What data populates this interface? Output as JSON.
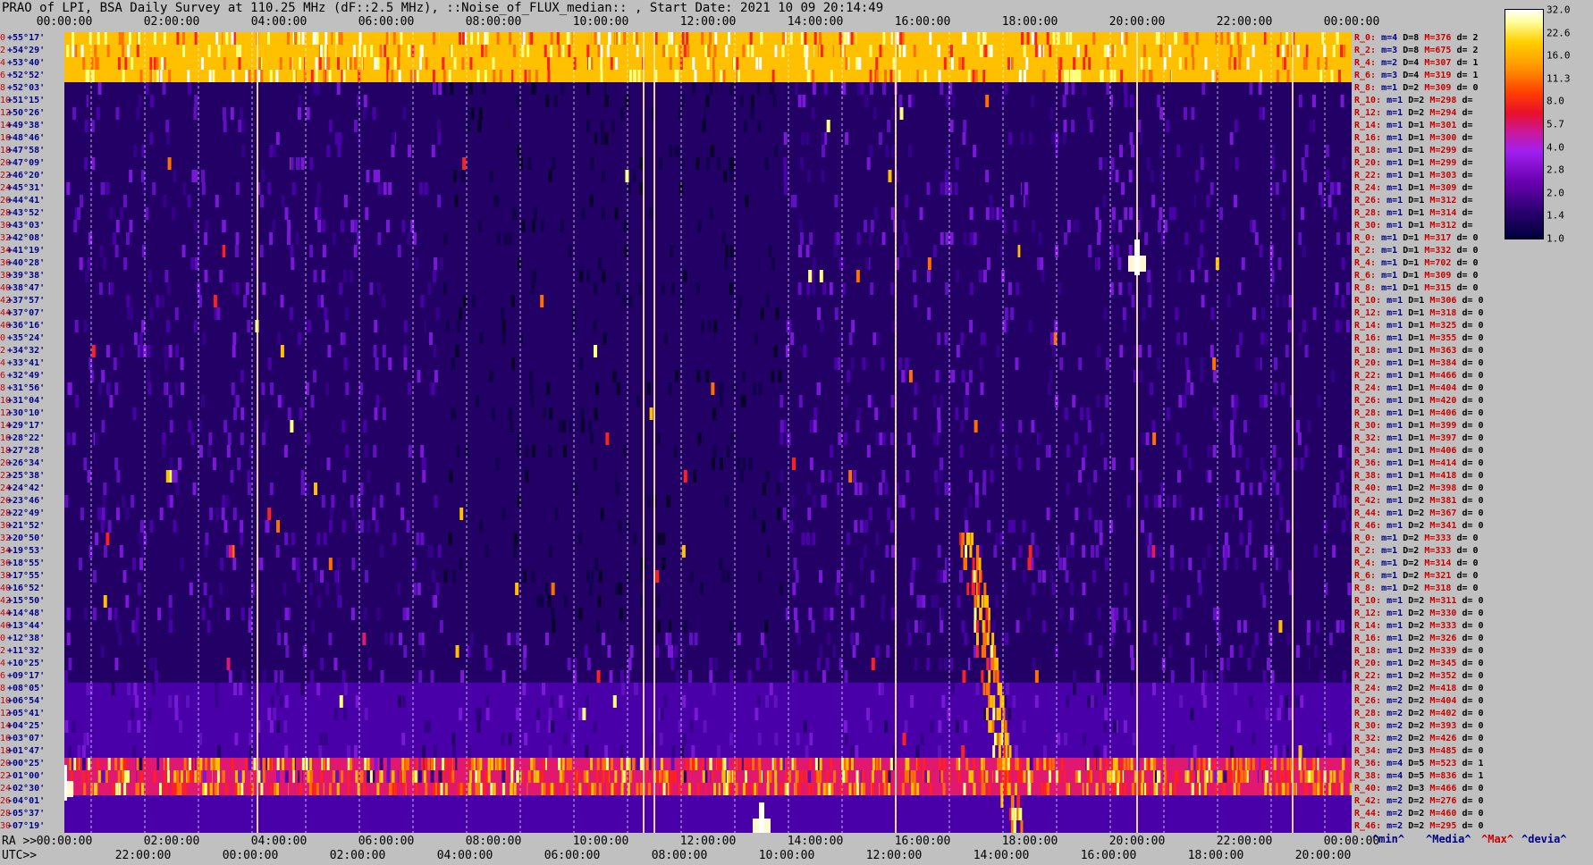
{
  "title": "PRAO of LPI, BSA Daily Survey at 110.25 MHz (dF::2.5 MHz), ::Noise_of_FLUX_median:: , Start Date: 2021 10 09 20:14:49",
  "top_time_ticks": [
    "00:00:00",
    "02:00:00",
    "04:00:00",
    "06:00:00",
    "08:00:00",
    "10:00:00",
    "12:00:00",
    "14:00:00",
    "16:00:00",
    "18:00:00",
    "20:00:00",
    "22:00:00",
    "00:00:00"
  ],
  "bottom_ra_label": "RA >>",
  "bottom_utc_label": "UTC>>",
  "bottom_ra_ticks": [
    "00:00:00",
    "02:00:00",
    "04:00:00",
    "06:00:00",
    "08:00:00",
    "10:00:00",
    "12:00:00",
    "14:00:00",
    "16:00:00",
    "18:00:00",
    "20:00:00",
    "22:00:00",
    "00:00:00"
  ],
  "bottom_utc_ticks": [
    "22:00:00",
    "00:00:00",
    "02:00:00",
    "04:00:00",
    "06:00:00",
    "08:00:00",
    "10:00:00",
    "12:00:00",
    "14:00:00",
    "16:00:00",
    "18:00:00",
    "20:00:00"
  ],
  "colorbar": {
    "labels": [
      "32.0",
      "22.6",
      "16.0",
      "11.3",
      "8.0",
      "5.7",
      "4.0",
      "2.8",
      "2.0",
      "1.4",
      "1.0"
    ],
    "colors": [
      "#00003a",
      "#6a00b0",
      "#c818a0",
      "#e8102a",
      "#ff9000",
      "#ffffa0",
      "#ffffff"
    ]
  },
  "legend": {
    "min": "^min^",
    "media": "^Media^",
    "max": "^Max^",
    "devia": "^devia^"
  },
  "rows": [
    {
      "idx": "0",
      "dec": "+55°17'",
      "stat": {
        "r": "R_0:",
        "m": "m=4",
        "D": "D=8",
        "M": "M=376",
        "d": "d= 2"
      }
    },
    {
      "idx": "2",
      "dec": "+54°29'",
      "stat": {
        "r": "R_2:",
        "m": "m=3",
        "D": "D=8",
        "M": "M=675",
        "d": "d= 2"
      }
    },
    {
      "idx": "4",
      "dec": "+53°40'",
      "stat": {
        "r": "R_4:",
        "m": "m=2",
        "D": "D=4",
        "M": "M=307",
        "d": "d= 1"
      }
    },
    {
      "idx": "6",
      "dec": "+52°52'",
      "stat": {
        "r": "R_6:",
        "m": "m=3",
        "D": "D=4",
        "M": "M=319",
        "d": "d= 1"
      }
    },
    {
      "idx": "8",
      "dec": "+52°03'",
      "stat": {
        "r": "R_8:",
        "m": "m=1",
        "D": "D=2",
        "M": "M=309",
        "d": "d= 0"
      }
    },
    {
      "idx": "10",
      "dec": "+51°15'",
      "stat": {
        "r": "R_10:",
        "m": "m=1",
        "D": "D=2",
        "M": "M=298",
        "d": "d="
      }
    },
    {
      "idx": "12",
      "dec": "+50°26'",
      "stat": {
        "r": "R_12:",
        "m": "m=1",
        "D": "D=2",
        "M": "M=294",
        "d": "d="
      }
    },
    {
      "idx": "14",
      "dec": "+49°38'",
      "stat": {
        "r": "R_14:",
        "m": "m=1",
        "D": "D=1",
        "M": "M=301",
        "d": "d="
      }
    },
    {
      "idx": "16",
      "dec": "+48°46'",
      "stat": {
        "r": "R_16:",
        "m": "m=1",
        "D": "D=1",
        "M": "M=300",
        "d": "d="
      }
    },
    {
      "idx": "18",
      "dec": "+47°58'",
      "stat": {
        "r": "R_18:",
        "m": "m=1",
        "D": "D=1",
        "M": "M=299",
        "d": "d="
      }
    },
    {
      "idx": "20",
      "dec": "+47°09'",
      "stat": {
        "r": "R_20:",
        "m": "m=1",
        "D": "D=1",
        "M": "M=299",
        "d": "d="
      }
    },
    {
      "idx": "22",
      "dec": "+46°20'",
      "stat": {
        "r": "R_22:",
        "m": "m=1",
        "D": "D=1",
        "M": "M=303",
        "d": "d="
      }
    },
    {
      "idx": "24",
      "dec": "+45°31'",
      "stat": {
        "r": "R_24:",
        "m": "m=1",
        "D": "D=1",
        "M": "M=309",
        "d": "d="
      }
    },
    {
      "idx": "26",
      "dec": "+44°41'",
      "stat": {
        "r": "R_26:",
        "m": "m=1",
        "D": "D=1",
        "M": "M=312",
        "d": "d="
      }
    },
    {
      "idx": "28",
      "dec": "+43°52'",
      "stat": {
        "r": "R_28:",
        "m": "m=1",
        "D": "D=1",
        "M": "M=314",
        "d": "d="
      }
    },
    {
      "idx": "30",
      "dec": "+43°03'",
      "stat": {
        "r": "R_30:",
        "m": "m=1",
        "D": "D=1",
        "M": "M=312",
        "d": "d="
      }
    },
    {
      "idx": "32",
      "dec": "+42°08'",
      "stat": {
        "r": "R_0:",
        "m": "m=1",
        "D": "D=1",
        "M": "M=317",
        "d": "d= 0"
      }
    },
    {
      "idx": "34",
      "dec": "+41°19'",
      "stat": {
        "r": "R_2:",
        "m": "m=1",
        "D": "D=1",
        "M": "M=332",
        "d": "d= 0"
      }
    },
    {
      "idx": "36",
      "dec": "+40°28'",
      "stat": {
        "r": "R_4:",
        "m": "m=1",
        "D": "D=1",
        "M": "M=702",
        "d": "d= 0"
      }
    },
    {
      "idx": "38",
      "dec": "+39°38'",
      "stat": {
        "r": "R_6:",
        "m": "m=1",
        "D": "D=1",
        "M": "M=309",
        "d": "d= 0"
      }
    },
    {
      "idx": "40",
      "dec": "+38°47'",
      "stat": {
        "r": "R_8:",
        "m": "m=1",
        "D": "D=1",
        "M": "M=315",
        "d": "d= 0"
      }
    },
    {
      "idx": "42",
      "dec": "+37°57'",
      "stat": {
        "r": "R_10:",
        "m": "m=1",
        "D": "D=1",
        "M": "M=306",
        "d": "d= 0"
      }
    },
    {
      "idx": "44",
      "dec": "+37°07'",
      "stat": {
        "r": "R_12:",
        "m": "m=1",
        "D": "D=1",
        "M": "M=318",
        "d": "d= 0"
      }
    },
    {
      "idx": "46",
      "dec": "+36°16'",
      "stat": {
        "r": "R_14:",
        "m": "m=1",
        "D": "D=1",
        "M": "M=325",
        "d": "d= 0"
      }
    },
    {
      "idx": "0",
      "dec": "+35°24'",
      "stat": {
        "r": "R_16:",
        "m": "m=1",
        "D": "D=1",
        "M": "M=355",
        "d": "d= 0"
      }
    },
    {
      "idx": "2",
      "dec": "+34°32'",
      "stat": {
        "r": "R_18:",
        "m": "m=1",
        "D": "D=1",
        "M": "M=363",
        "d": "d= 0"
      }
    },
    {
      "idx": "4",
      "dec": "+33°41'",
      "stat": {
        "r": "R_20:",
        "m": "m=1",
        "D": "D=1",
        "M": "M=384",
        "d": "d= 0"
      }
    },
    {
      "idx": "6",
      "dec": "+32°49'",
      "stat": {
        "r": "R_22:",
        "m": "m=1",
        "D": "D=1",
        "M": "M=466",
        "d": "d= 0"
      }
    },
    {
      "idx": "8",
      "dec": "+31°56'",
      "stat": {
        "r": "R_24:",
        "m": "m=1",
        "D": "D=1",
        "M": "M=404",
        "d": "d= 0"
      }
    },
    {
      "idx": "10",
      "dec": "+31°04'",
      "stat": {
        "r": "R_26:",
        "m": "m=1",
        "D": "D=1",
        "M": "M=420",
        "d": "d= 0"
      }
    },
    {
      "idx": "12",
      "dec": "+30°10'",
      "stat": {
        "r": "R_28:",
        "m": "m=1",
        "D": "D=1",
        "M": "M=406",
        "d": "d= 0"
      }
    },
    {
      "idx": "14",
      "dec": "+29°17'",
      "stat": {
        "r": "R_30:",
        "m": "m=1",
        "D": "D=1",
        "M": "M=399",
        "d": "d= 0"
      }
    },
    {
      "idx": "16",
      "dec": "+28°22'",
      "stat": {
        "r": "R_32:",
        "m": "m=1",
        "D": "D=1",
        "M": "M=397",
        "d": "d= 0"
      }
    },
    {
      "idx": "18",
      "dec": "+27°28'",
      "stat": {
        "r": "R_34:",
        "m": "m=1",
        "D": "D=1",
        "M": "M=406",
        "d": "d= 0"
      }
    },
    {
      "idx": "20",
      "dec": "+26°34'",
      "stat": {
        "r": "R_36:",
        "m": "m=1",
        "D": "D=1",
        "M": "M=414",
        "d": "d= 0"
      }
    },
    {
      "idx": "22",
      "dec": "+25°38'",
      "stat": {
        "r": "R_38:",
        "m": "m=1",
        "D": "D=1",
        "M": "M=418",
        "d": "d= 0"
      }
    },
    {
      "idx": "24",
      "dec": "+24°42'",
      "stat": {
        "r": "R_40:",
        "m": "m=1",
        "D": "D=2",
        "M": "M=398",
        "d": "d= 0"
      }
    },
    {
      "idx": "26",
      "dec": "+23°46'",
      "stat": {
        "r": "R_42:",
        "m": "m=1",
        "D": "D=2",
        "M": "M=381",
        "d": "d= 0"
      }
    },
    {
      "idx": "28",
      "dec": "+22°49'",
      "stat": {
        "r": "R_44:",
        "m": "m=1",
        "D": "D=2",
        "M": "M=367",
        "d": "d= 0"
      }
    },
    {
      "idx": "30",
      "dec": "+21°52'",
      "stat": {
        "r": "R_46:",
        "m": "m=1",
        "D": "D=2",
        "M": "M=341",
        "d": "d= 0"
      }
    },
    {
      "idx": "32",
      "dec": "+20°50'",
      "stat": {
        "r": "R_0:",
        "m": "m=1",
        "D": "D=2",
        "M": "M=333",
        "d": "d= 0"
      }
    },
    {
      "idx": "34",
      "dec": "+19°53'",
      "stat": {
        "r": "R_2:",
        "m": "m=1",
        "D": "D=2",
        "M": "M=333",
        "d": "d= 0"
      }
    },
    {
      "idx": "36",
      "dec": "+18°55'",
      "stat": {
        "r": "R_4:",
        "m": "m=1",
        "D": "D=2",
        "M": "M=314",
        "d": "d= 0"
      }
    },
    {
      "idx": "38",
      "dec": "+17°55'",
      "stat": {
        "r": "R_6:",
        "m": "m=1",
        "D": "D=2",
        "M": "M=321",
        "d": "d= 0"
      }
    },
    {
      "idx": "40",
      "dec": "+16°52'",
      "stat": {
        "r": "R_8:",
        "m": "m=1",
        "D": "D=2",
        "M": "M=318",
        "d": "d= 0"
      }
    },
    {
      "idx": "42",
      "dec": "+15°50'",
      "stat": {
        "r": "R_10:",
        "m": "m=1",
        "D": "D=2",
        "M": "M=311",
        "d": "d= 0"
      }
    },
    {
      "idx": "44",
      "dec": "+14°48'",
      "stat": {
        "r": "R_12:",
        "m": "m=1",
        "D": "D=2",
        "M": "M=330",
        "d": "d= 0"
      }
    },
    {
      "idx": "46",
      "dec": "+13°44'",
      "stat": {
        "r": "R_14:",
        "m": "m=1",
        "D": "D=2",
        "M": "M=333",
        "d": "d= 0"
      }
    },
    {
      "idx": "0",
      "dec": "+12°38'",
      "stat": {
        "r": "R_16:",
        "m": "m=1",
        "D": "D=2",
        "M": "M=326",
        "d": "d= 0"
      }
    },
    {
      "idx": "2",
      "dec": "+11°32'",
      "stat": {
        "r": "R_18:",
        "m": "m=1",
        "D": "D=2",
        "M": "M=339",
        "d": "d= 0"
      }
    },
    {
      "idx": "4",
      "dec": "+10°25'",
      "stat": {
        "r": "R_20:",
        "m": "m=1",
        "D": "D=2",
        "M": "M=345",
        "d": "d= 0"
      }
    },
    {
      "idx": "6",
      "dec": "+09°17'",
      "stat": {
        "r": "R_22:",
        "m": "m=1",
        "D": "D=2",
        "M": "M=352",
        "d": "d= 0"
      }
    },
    {
      "idx": "8",
      "dec": "+08°05'",
      "stat": {
        "r": "R_24:",
        "m": "m=2",
        "D": "D=2",
        "M": "M=418",
        "d": "d= 0"
      }
    },
    {
      "idx": "10",
      "dec": "+06°54'",
      "stat": {
        "r": "R_26:",
        "m": "m=2",
        "D": "D=2",
        "M": "M=404",
        "d": "d= 0"
      }
    },
    {
      "idx": "12",
      "dec": "+05°41'",
      "stat": {
        "r": "R_28:",
        "m": "m=2",
        "D": "D=2",
        "M": "M=402",
        "d": "d= 0"
      }
    },
    {
      "idx": "14",
      "dec": "+04°25'",
      "stat": {
        "r": "R_30:",
        "m": "m=2",
        "D": "D=2",
        "M": "M=393",
        "d": "d= 0"
      }
    },
    {
      "idx": "16",
      "dec": "+03°07'",
      "stat": {
        "r": "R_32:",
        "m": "m=2",
        "D": "D=2",
        "M": "M=426",
        "d": "d= 0"
      }
    },
    {
      "idx": "18",
      "dec": "+01°47'",
      "stat": {
        "r": "R_34:",
        "m": "m=2",
        "D": "D=3",
        "M": "M=485",
        "d": "d= 0"
      }
    },
    {
      "idx": "20",
      "dec": "+00°25'",
      "stat": {
        "r": "R_36:",
        "m": "m=4",
        "D": "D=5",
        "M": "M=523",
        "d": "d= 1"
      }
    },
    {
      "idx": "22",
      "dec": "-01°00'",
      "stat": {
        "r": "R_38:",
        "m": "m=4",
        "D": "D=5",
        "M": "M=836",
        "d": "d= 1"
      }
    },
    {
      "idx": "24",
      "dec": "-02°30'",
      "stat": {
        "r": "R_40:",
        "m": "m=2",
        "D": "D=3",
        "M": "M=466",
        "d": "d= 0"
      }
    },
    {
      "idx": "26",
      "dec": "-04°01'",
      "stat": {
        "r": "R_42:",
        "m": "m=2",
        "D": "D=2",
        "M": "M=276",
        "d": "d= 0"
      }
    },
    {
      "idx": "28",
      "dec": "-05°37'",
      "stat": {
        "r": "R_44:",
        "m": "m=2",
        "D": "D=2",
        "M": "M=460",
        "d": "d= 0"
      }
    },
    {
      "idx": "30",
      "dec": "-07°19'",
      "stat": {
        "r": "R_46:",
        "m": "m=2",
        "D": "D=2",
        "M": "M=295",
        "d": "d= 0"
      }
    }
  ],
  "chart_data": {
    "type": "heatmap",
    "title": "PRAO of LPI, BSA Daily Survey at 110.25 MHz (dF::2.5 MHz), ::Noise_of_FLUX_median:: , Start Date: 2021 10 09 20:14:49",
    "x_top_label": "",
    "x_bottom_label_ra": "RA >>",
    "x_bottom_label_utc": "UTC>>",
    "x_range_hours": [
      0,
      24
    ],
    "y_unit": "Declination",
    "colorbar_range": [
      1.0,
      32.0
    ],
    "colorbar_scale": "log",
    "bright_features": [
      {
        "ra_hour": 0.0,
        "dec_row_from": 0,
        "dec_row_to": 3,
        "level": 22.6
      },
      {
        "ra_hour": 0.0,
        "dec_row": 60,
        "level": 8.0
      },
      {
        "ra_hour": 20.0,
        "dec_row": 18,
        "level": 32.0
      },
      {
        "ra_hour": 13.0,
        "dec_row": 63,
        "level": 32.0
      },
      {
        "ra_hour": 10.8,
        "dec_row_from": 0,
        "dec_row_to": 63,
        "level": 16.0
      }
    ]
  }
}
